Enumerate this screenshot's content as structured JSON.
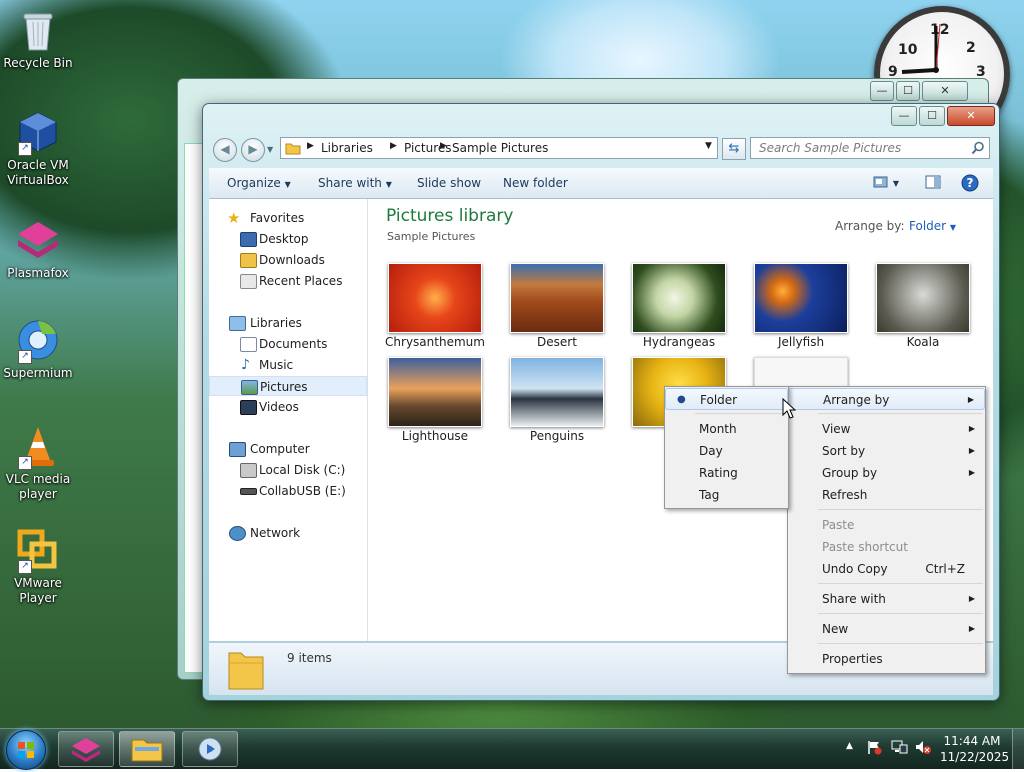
{
  "desktop": {
    "icons": [
      {
        "label": "Recycle Bin"
      },
      {
        "label": "Oracle VM VirtualBox"
      },
      {
        "label": "Plasmafox"
      },
      {
        "label": "Supermium"
      },
      {
        "label": "VLC media player"
      },
      {
        "label": "VMware Player"
      }
    ],
    "clock": {
      "n12": "12",
      "n2": "2",
      "n3": "3",
      "n9": "9",
      "n10": "10"
    }
  },
  "window": {
    "caption_buttons": {
      "minimize": "—",
      "maximize": "☐",
      "close": "✕"
    },
    "breadcrumb": [
      "Libraries",
      "Pictures",
      "Sample Pictures"
    ],
    "search_placeholder": "Search Sample Pictures",
    "toolbar": {
      "organize": "Organize",
      "share_with": "Share with",
      "slide_show": "Slide show",
      "new_folder": "New folder"
    },
    "nav": {
      "favorites": "Favorites",
      "desktop": "Desktop",
      "downloads": "Downloads",
      "recent_places": "Recent Places",
      "libraries": "Libraries",
      "documents": "Documents",
      "music": "Music",
      "pictures": "Pictures",
      "videos": "Videos",
      "computer": "Computer",
      "local_disk": "Local Disk (C:)",
      "collabusb": "CollabUSB (E:)",
      "network": "Network"
    },
    "library_title": "Pictures library",
    "library_subtitle": "Sample Pictures",
    "arrange_by_label": "Arrange by:",
    "arrange_by_value": "Folder",
    "files": [
      "Chrysanthemum",
      "Desert",
      "Hydrangeas",
      "Jellyfish",
      "Koala",
      "Lighthouse",
      "Penguins"
    ],
    "status": "9 items"
  },
  "context_menu": {
    "arrange_by": "Arrange by",
    "view": "View",
    "sort_by": "Sort by",
    "group_by": "Group by",
    "refresh": "Refresh",
    "paste": "Paste",
    "paste_shortcut": "Paste shortcut",
    "undo_copy": "Undo Copy",
    "undo_shortcut": "Ctrl+Z",
    "share_with": "Share with",
    "new": "New",
    "properties": "Properties"
  },
  "submenu": {
    "folder": "Folder",
    "month": "Month",
    "day": "Day",
    "rating": "Rating",
    "tag": "Tag"
  },
  "taskbar": {
    "time": "11:44 AM",
    "date": "11/22/2025"
  },
  "colors": {
    "accent_title": "#1e7a3c",
    "link_blue": "#1e5fb8",
    "menu_highlight": "#e1ecf7"
  }
}
